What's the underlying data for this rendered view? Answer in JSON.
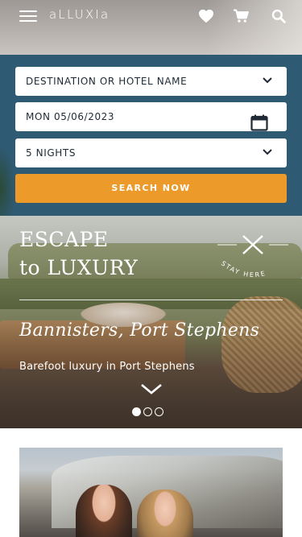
{
  "header": {
    "logo_text": "aLLUXIa",
    "icons": [
      "menu-icon",
      "heart-icon",
      "cart-icon",
      "search-icon"
    ]
  },
  "search": {
    "destination_placeholder": "DESTINATION OR HOTEL NAME",
    "date_value": "MON 05/06/2023",
    "nights_value": "5 NIGHTS",
    "button_label": "SEARCH NOW"
  },
  "hero": {
    "title_line1": "ESCAPE",
    "title_line2": "to LUXURY",
    "badge_text": "STAY HERE",
    "script_title": "Bannisters, Port Stephens",
    "subtitle": "Barefoot luxury in Port Stephens",
    "slide_count": 3,
    "active_slide": 1
  },
  "colors": {
    "panel_bg": "#2f5a74",
    "accent_orange": "#ec9a2a",
    "text_dark": "#1f2a36",
    "white": "#ffffff"
  }
}
